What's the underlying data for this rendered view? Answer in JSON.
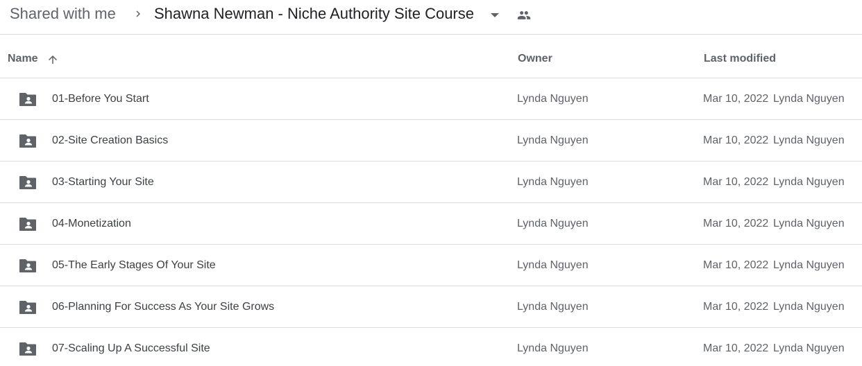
{
  "breadcrumb": {
    "root": "Shared with me",
    "current": "Shawna Newman - Niche Authority Site Course",
    "separator_icon": "chevron-right-icon",
    "dropdown_icon": "caret-down-icon",
    "shared_icon": "people-icon"
  },
  "columns": {
    "name": "Name",
    "owner": "Owner",
    "last_modified": "Last modified",
    "sort_icon": "arrow-up-icon"
  },
  "colors": {
    "icon_gray": "#5f6368",
    "text_dark": "#3c4043",
    "divider": "#dadce0"
  },
  "rows": [
    {
      "name": "01-Before You Start",
      "owner": "Lynda Nguyen",
      "date": "Mar 10, 2022",
      "modified_by": "Lynda Nguyen",
      "icon": "shared-folder-icon"
    },
    {
      "name": "02-Site Creation Basics",
      "owner": "Lynda Nguyen",
      "date": "Mar 10, 2022",
      "modified_by": "Lynda Nguyen",
      "icon": "shared-folder-icon"
    },
    {
      "name": "03-Starting Your Site",
      "owner": "Lynda Nguyen",
      "date": "Mar 10, 2022",
      "modified_by": "Lynda Nguyen",
      "icon": "shared-folder-icon"
    },
    {
      "name": "04-Monetization",
      "owner": "Lynda Nguyen",
      "date": "Mar 10, 2022",
      "modified_by": "Lynda Nguyen",
      "icon": "shared-folder-icon"
    },
    {
      "name": "05-The Early Stages Of Your Site",
      "owner": "Lynda Nguyen",
      "date": "Mar 10, 2022",
      "modified_by": "Lynda Nguyen",
      "icon": "shared-folder-icon"
    },
    {
      "name": "06-Planning For Success As Your Site Grows",
      "owner": "Lynda Nguyen",
      "date": "Mar 10, 2022",
      "modified_by": "Lynda Nguyen",
      "icon": "shared-folder-icon"
    },
    {
      "name": "07-Scaling Up A Successful Site",
      "owner": "Lynda Nguyen",
      "date": "Mar 10, 2022",
      "modified_by": "Lynda Nguyen",
      "icon": "shared-folder-icon"
    }
  ]
}
